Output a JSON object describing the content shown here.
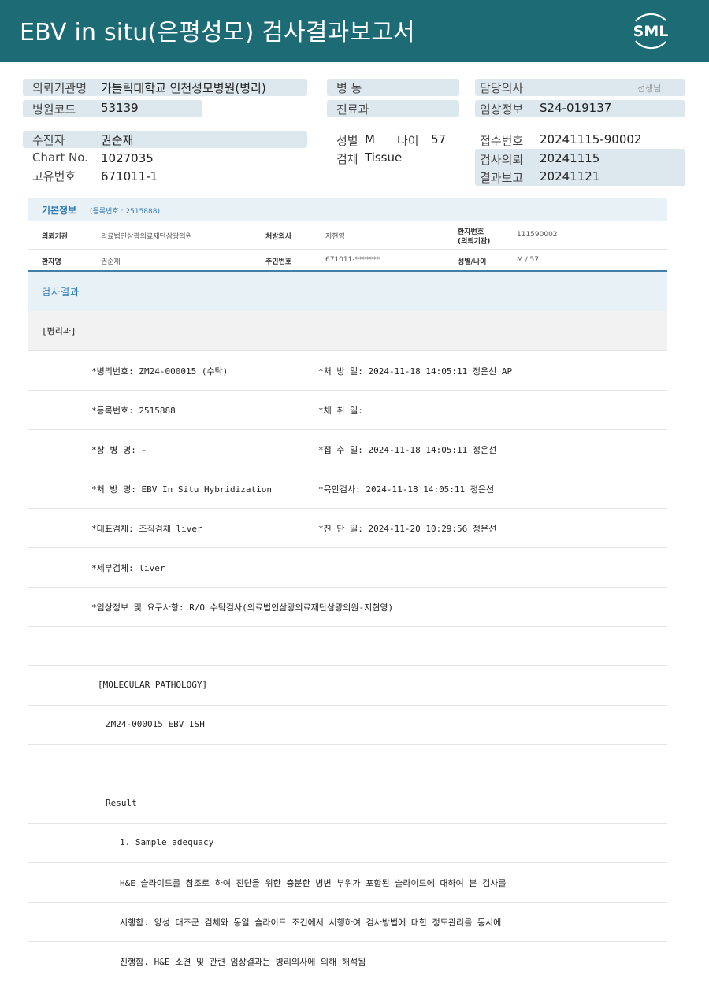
{
  "header": {
    "title": "EBV in situ(은평성모) 검사결과보고서",
    "logo_text": "SML",
    "background": "#1d6b74"
  },
  "info": {
    "requesting_org_label": "의뢰기관명",
    "requesting_org_value": "가톨릭대학교 인천성모병원(병리)",
    "hospital_code_label": "병원코드",
    "hospital_code_value": "53139",
    "ward_label": "병 동",
    "department_label": "진료과",
    "doctor_label": "담당의사",
    "doctor_suffix": "선생님",
    "clinical_info_label": "임상정보",
    "clinical_info_value": "S24-019137",
    "patient_label": "수진자",
    "patient_value": "권순재",
    "chart_label": "Chart No.",
    "chart_value": "1027035",
    "unique_label": "고유번호",
    "unique_value": "671011-1",
    "sex_label": "성별",
    "sex_value": "M",
    "age_label": "나이",
    "age_value": "57",
    "specimen_label": "검체",
    "specimen_value": "Tissue",
    "receipt_label": "접수번호",
    "receipt_value": "20241115-90002",
    "request_date_label": "검사의뢰",
    "request_date_value": "20241115",
    "report_date_label": "결과보고",
    "report_date_value": "20241121"
  },
  "basic": {
    "title": "기본정보",
    "reg_no": "(등록번호 : 2515888)",
    "rows": [
      {
        "k1": "의뢰기관",
        "v1": "의료법인삼광의료재단삼광의원",
        "k2": "처방의사",
        "v2": "지현영",
        "k3a": "환자번호",
        "k3b": "(의뢰기관)",
        "v3": "111590002"
      },
      {
        "k1": "환자명",
        "v1": "권순재",
        "k2": "주민번호",
        "v2": "671011-*******",
        "k3a": "성별/나이",
        "k3b": "",
        "v3": "M / 57"
      }
    ]
  },
  "result": {
    "title": "검사결과",
    "dept": "[병리과]",
    "lines": [
      {
        "left": "*병리번호: ZM24-000015 (수탁)",
        "right": "*처 방 일: 2024-11-18 14:05:11  정은선 AP"
      },
      {
        "left": "*등록번호: 2515888",
        "right": "*채 취 일:"
      },
      {
        "left": "*상 병 명: -",
        "right": "*접 수 일: 2024-11-18 14:05:11  정은선"
      },
      {
        "left": "*처 방 명: EBV In Situ Hybridization",
        "right": "*육안검사: 2024-11-18 14:05:11  정은선"
      },
      {
        "left": "*대표검체: 조직검체 liver",
        "right": "*진 단 일: 2024-11-20 10:29:56  정은선"
      },
      {
        "left": "*세부검체: liver",
        "right": ""
      },
      {
        "left": "*임상정보 및 요구사항: R/O 수탁검사(의료법인삼광의료재단삼광의원-지현영)",
        "right": ""
      }
    ],
    "molecular": "[MOLECULAR PATHOLOGY]",
    "test_line": "ZM24-000015     EBV ISH",
    "result_label": "Result",
    "item1": "1. Sample adequacy",
    "para1": "H&E 슬라이드를 참조로 하여 진단을 위한 충분한 병변 부위가 포함된 슬라이드에 대하여 본 검사를",
    "para2": "시행함. 양성 대조군 검체와 동일 슬라이드 조건에서 시행하여 검사방법에 대한 정도관리를 동시에",
    "para3": "진행함. H&E 소견 및 관련 임상결과는 병리의사에 의해 해석됨"
  }
}
